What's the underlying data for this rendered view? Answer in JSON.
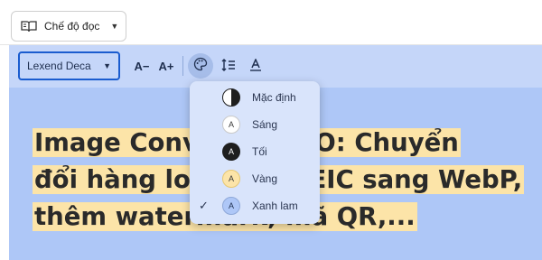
{
  "topbar": {
    "mode_label": "Chế độ đọc"
  },
  "toolbar": {
    "font_value": "Lexend Deca",
    "decrease_label": "A−",
    "increase_label": "A+"
  },
  "article": {
    "line1": "Image Converter PRO: Chuyển",
    "line2": "đổi hàng loạt ảnh HEIC sang WebP,",
    "line3": "thêm watermark, mã QR,..."
  },
  "theme_menu": {
    "items": [
      {
        "label": "Mặc định",
        "swatch": "half",
        "checked": false
      },
      {
        "label": "Sáng",
        "swatch_letter": "A",
        "bg": "#ffffff",
        "fg": "#3a3a3a",
        "checked": false
      },
      {
        "label": "Tối",
        "swatch_letter": "A",
        "bg": "#1e1e1e",
        "fg": "#ffffff",
        "checked": false
      },
      {
        "label": "Vàng",
        "swatch_letter": "A",
        "bg": "#fce4a8",
        "fg": "#3a3a3a",
        "checked": false
      },
      {
        "label": "Xanh lam",
        "swatch_letter": "A",
        "bg": "#aec7f7",
        "fg": "#1f2f4f",
        "checked": true
      }
    ]
  },
  "colors": {
    "accent_blue": "#1a5ccf",
    "reader_bg": "#aec7f7",
    "highlight": "#fce4a8"
  }
}
